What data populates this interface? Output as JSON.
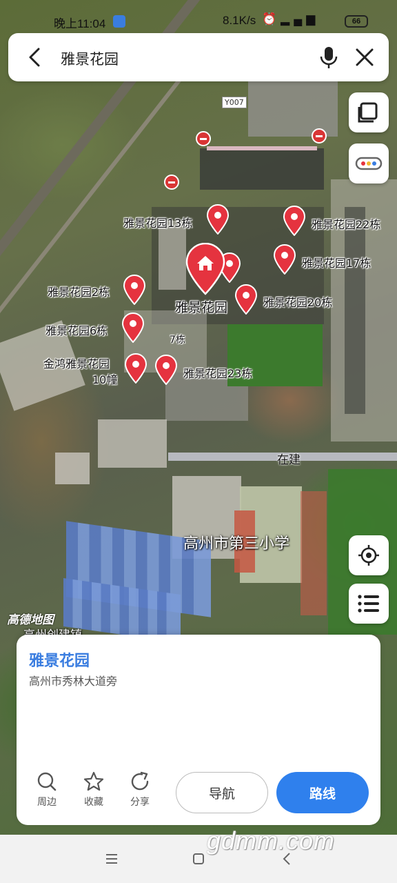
{
  "status_bar": {
    "time": "晚上11:04",
    "speed": "8.1K/s",
    "battery": "66"
  },
  "search": {
    "query": "雅景花园"
  },
  "map": {
    "road_label": "Y007",
    "amap_logo": "高德地图",
    "bottom_partial_label": "高州创建镇",
    "markers": [
      {
        "label": "雅景花园13栋"
      },
      {
        "label": "雅景花园22栋"
      },
      {
        "label": "雅景花园17栋"
      },
      {
        "label": "雅景花园2栋"
      },
      {
        "label": "雅景花园20栋"
      },
      {
        "label": "雅景花园6栋"
      },
      {
        "label": "7栋"
      },
      {
        "label": "金鸿雅景花园"
      },
      {
        "label": "10幢"
      },
      {
        "label": "雅景花园23栋"
      }
    ],
    "main_marker_label": "雅景花园",
    "under_construction": "在建",
    "school": "高州市第三小学"
  },
  "card": {
    "title": "雅景花园",
    "address": "高州市秀林大道旁",
    "actions": [
      {
        "label": "周边",
        "icon": "search-icon"
      },
      {
        "label": "收藏",
        "icon": "star-icon"
      },
      {
        "label": "分享",
        "icon": "share-icon"
      }
    ],
    "navigate_label": "导航",
    "route_label": "路线"
  },
  "watermark": "gdmm.com",
  "colors": {
    "accent": "#2f80ed",
    "title_blue": "#3a7de0",
    "marker_red": "#e5333f"
  }
}
